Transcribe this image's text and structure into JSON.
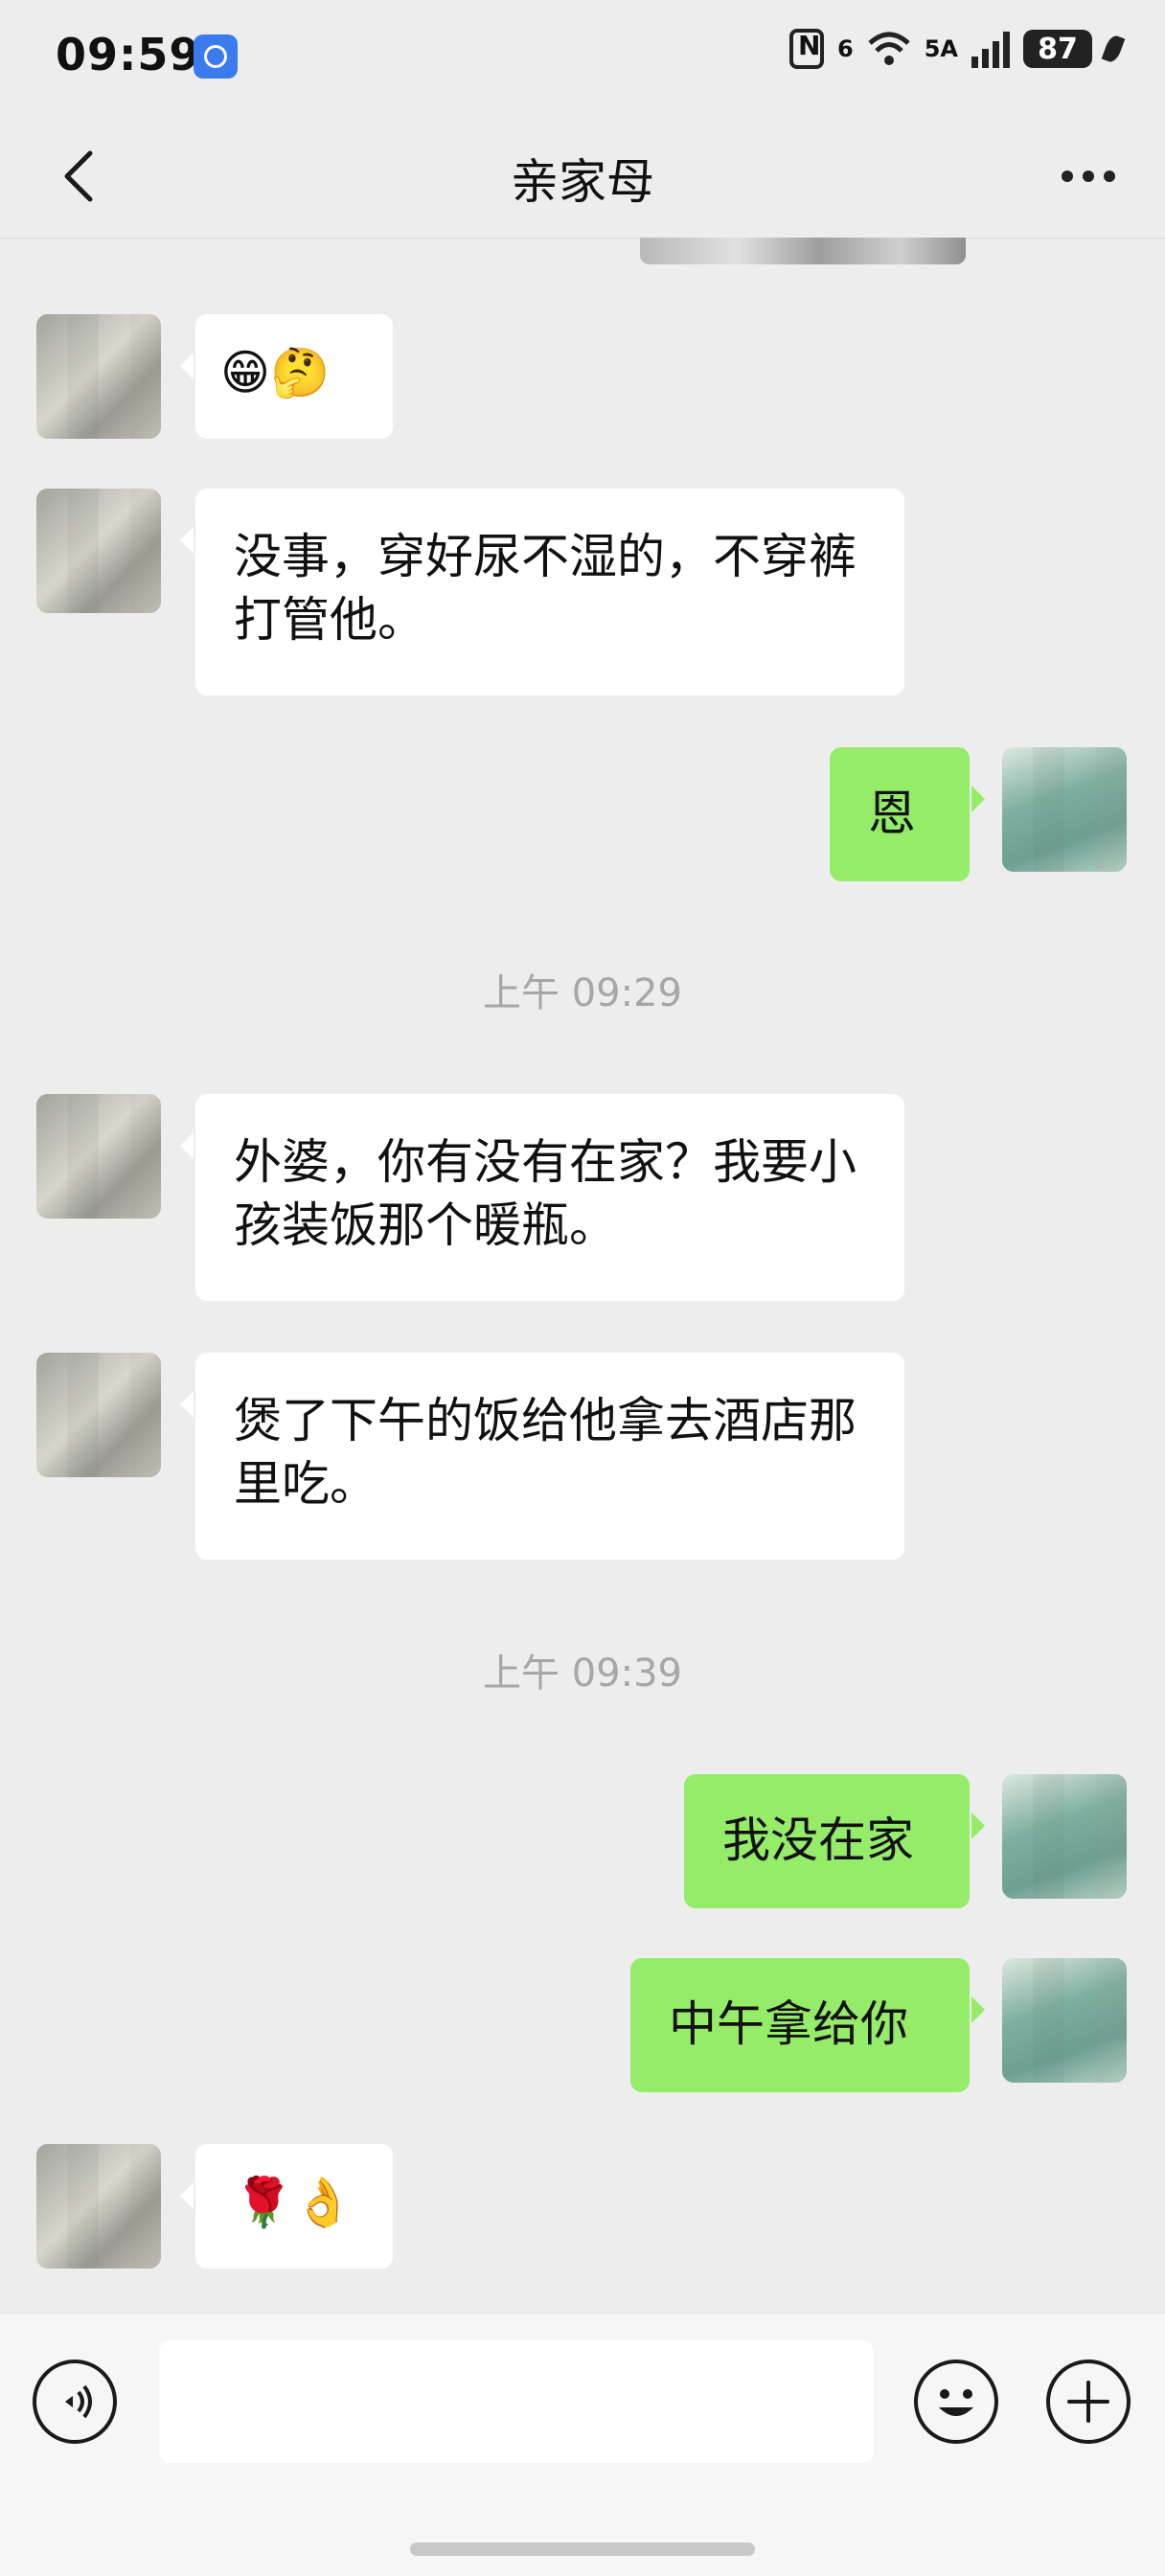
{
  "status_bar": {
    "time": "09:59",
    "network_label": "5A",
    "signal_label": "6",
    "battery": "87"
  },
  "header": {
    "title": "亲家母"
  },
  "messages": [
    {
      "side": "in",
      "text": "😁🤔"
    },
    {
      "side": "in",
      "text": "没事，穿好尿不湿的，不穿裤打管他。"
    },
    {
      "side": "out",
      "text": "恩"
    },
    {
      "timestamp": "上午 09:29"
    },
    {
      "side": "in",
      "text": "外婆，你有没有在家？我要小孩装饭那个暖瓶。"
    },
    {
      "side": "in",
      "text": "煲了下午的饭给他拿去酒店那里吃。"
    },
    {
      "timestamp": "上午 09:39"
    },
    {
      "side": "out",
      "text": "我没在家"
    },
    {
      "side": "out",
      "text": "中午拿给你"
    },
    {
      "side": "in",
      "text": "🌹👌"
    }
  ],
  "input": {
    "value": "",
    "placeholder": ""
  }
}
